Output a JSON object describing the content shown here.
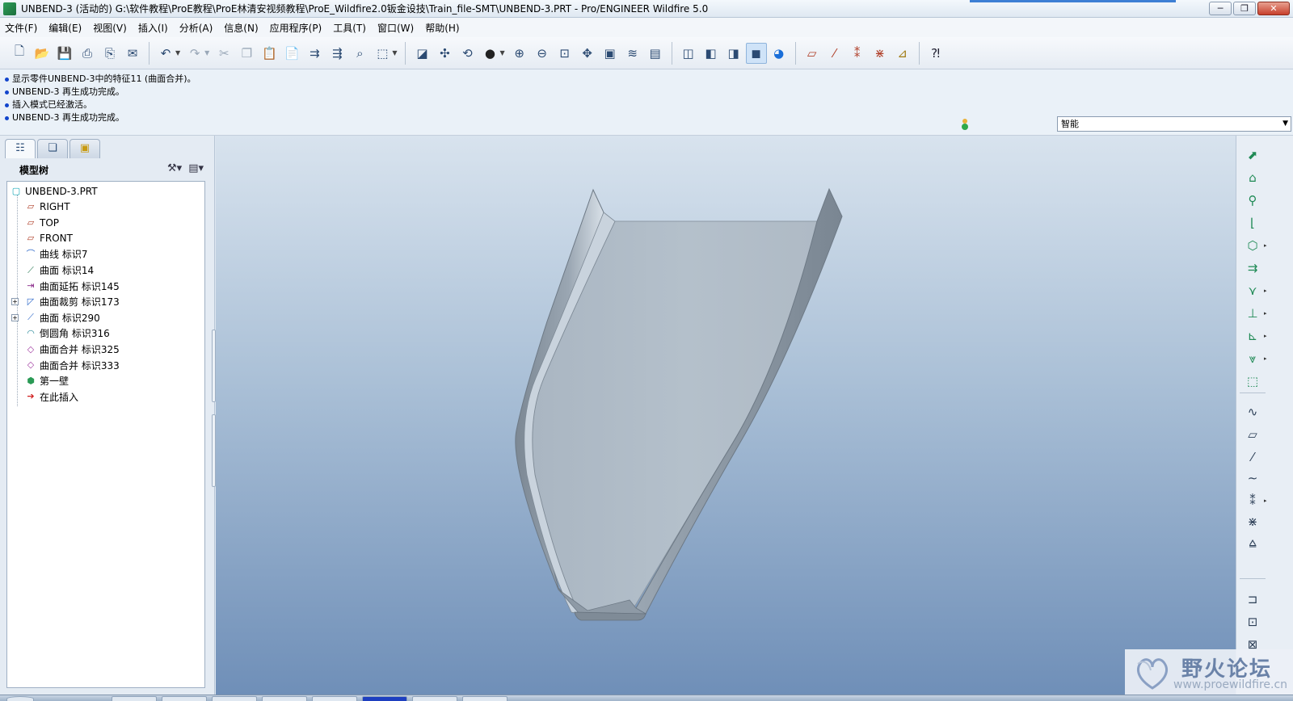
{
  "window": {
    "title": "UNBEND-3 (活动的) G:\\软件教程\\ProE教程\\ProE林清安视频教程\\ProE_Wildfire2.0钣金设技\\Train_file-SMT\\UNBEND-3.PRT - Pro/ENGINEER Wildfire 5.0",
    "minimize": "─",
    "restore": "❐",
    "close": "✕"
  },
  "menu": [
    "文件(F)",
    "编辑(E)",
    "视图(V)",
    "插入(I)",
    "分析(A)",
    "信息(N)",
    "应用程序(P)",
    "工具(T)",
    "窗口(W)",
    "帮助(H)"
  ],
  "toolbar": {
    "icons": [
      "new-icon",
      "open-icon",
      "save-icon",
      "print-icon",
      "print-preview-icon",
      "email-icon",
      "undo-icon",
      "redo-icon",
      "cut-icon",
      "copy-icon",
      "paste-icon",
      "paste-special-icon",
      "regenerate-icon",
      "regen-manager-icon",
      "find-icon",
      "select-box-icon",
      "repaint-icon",
      "spin-center-icon",
      "orient-icon",
      "appearance-icon",
      "zoom-in-icon",
      "zoom-out-icon",
      "refit-icon",
      "reorient-icon",
      "saved-views-icon",
      "layers-icon",
      "view-manager-icon",
      "wireframe-icon",
      "hidden-line-icon",
      "no-hidden-icon",
      "shading-icon",
      "enhanced-realism-icon",
      "datum-planes-icon",
      "datum-axes-icon",
      "datum-points-icon",
      "coord-sys-icon",
      "annotations-icon",
      "context-help-icon"
    ]
  },
  "messages": [
    "显示零件UNBEND-3中的特征11 (曲面合并)。",
    "UNBEND-3 再生成功完成。",
    "插入模式已经激活。",
    "UNBEND-3 再生成功完成。"
  ],
  "filter": {
    "value": "智能"
  },
  "navigator": {
    "tabs": [
      "model-tree-tab",
      "layer-tab",
      "folder-browser-tab"
    ],
    "tree_title": "模型树",
    "tree": [
      {
        "label": "UNBEND-3.PRT",
        "icon": "part-icon",
        "color": "#17a8b8",
        "expandable": false
      },
      {
        "label": "RIGHT",
        "icon": "datum-plane-icon",
        "color": "#b0402a",
        "expandable": false
      },
      {
        "label": "TOP",
        "icon": "datum-plane-icon",
        "color": "#b0402a",
        "expandable": false
      },
      {
        "label": "FRONT",
        "icon": "datum-plane-icon",
        "color": "#b0402a",
        "expandable": false
      },
      {
        "label": "曲线 标识7",
        "icon": "curve-icon",
        "color": "#2a66c8",
        "expandable": false
      },
      {
        "label": "曲面 标识14",
        "icon": "surface-icon",
        "color": "#2a7a55",
        "expandable": false
      },
      {
        "label": "曲面延拓 标识145",
        "icon": "extend-icon",
        "color": "#8a2a8a",
        "expandable": false
      },
      {
        "label": "曲面裁剪 标识173",
        "icon": "trim-icon",
        "color": "#2a66c8",
        "expandable": true
      },
      {
        "label": "曲面 标识290",
        "icon": "surface-icon",
        "color": "#2a66c8",
        "expandable": true
      },
      {
        "label": "倒圆角 标识316",
        "icon": "round-icon",
        "color": "#2a8a9a",
        "expandable": false
      },
      {
        "label": "曲面合并 标识325",
        "icon": "merge-icon",
        "color": "#a03aa0",
        "expandable": false
      },
      {
        "label": "曲面合并 标识333",
        "icon": "merge-icon",
        "color": "#a03aa0",
        "expandable": false
      },
      {
        "label": "第一壁",
        "icon": "first-wall-icon",
        "color": "#2a9a55",
        "expandable": false
      },
      {
        "label": "在此插入",
        "icon": "insert-here-icon",
        "color": "#d02020",
        "expandable": false
      }
    ]
  },
  "right_toolbar": {
    "icons": [
      "conversion-icon",
      "unattached-wall-icon",
      "flat-wall-icon",
      "flange-wall-icon",
      "extend-wall-icon",
      "merge-wall-icon",
      "rip-icon",
      "bend-icon",
      "edge-bend-icon",
      "unbend-icon",
      "bend-back-icon",
      "datum-curve-icon",
      "datum-plane-tool-icon",
      "datum-axis-tool-icon",
      "sketched-curve-icon",
      "datum-point-tool-icon",
      "coord-system-tool-icon",
      "analysis-tool-icon",
      "flat-pattern-icon",
      "form-icon",
      "punch-icon"
    ]
  },
  "watermark": {
    "text": "野火论坛",
    "url": "www.proewildfire.cn"
  },
  "colors": {
    "accent": "#3d7fd4",
    "viewport_top": "#d8e3ee",
    "viewport_bottom": "#6f8fb8",
    "part_face": "#b0bcc8",
    "part_wall": "#8a96a2"
  }
}
